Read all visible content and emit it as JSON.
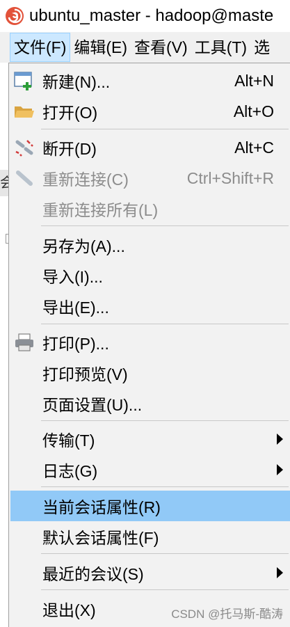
{
  "window": {
    "title": "ubuntu_master - hadoop@maste",
    "app_icon": "swirl-app-icon"
  },
  "menubar": {
    "items": [
      "文件(F)",
      "编辑(E)",
      "查看(V)",
      "工具(T)",
      "选"
    ]
  },
  "background": {
    "tab_fragment": "会"
  },
  "file_menu": {
    "items": [
      {
        "label": "新建(N)...",
        "shortcut": "Alt+N",
        "icon": "new-session-icon",
        "enabled": true
      },
      {
        "label": "打开(O)",
        "shortcut": "Alt+O",
        "icon": "open-folder-icon",
        "enabled": true
      },
      {
        "label": "断开(D)",
        "shortcut": "Alt+C",
        "icon": "disconnect-icon",
        "enabled": true
      },
      {
        "label": "重新连接(C)",
        "shortcut": "Ctrl+Shift+R",
        "icon": "reconnect-icon",
        "enabled": false
      },
      {
        "label": "重新连接所有(L)",
        "shortcut": "",
        "enabled": false
      },
      {
        "label": "另存为(A)...",
        "shortcut": "",
        "enabled": true
      },
      {
        "label": "导入(I)...",
        "shortcut": "",
        "enabled": true
      },
      {
        "label": "导出(E)...",
        "shortcut": "",
        "enabled": true
      },
      {
        "label": "打印(P)...",
        "shortcut": "",
        "icon": "printer-icon",
        "enabled": true
      },
      {
        "label": "打印预览(V)",
        "shortcut": "",
        "enabled": true
      },
      {
        "label": "页面设置(U)...",
        "shortcut": "",
        "enabled": true
      },
      {
        "label": "传输(T)",
        "shortcut": "",
        "submenu": true,
        "enabled": true
      },
      {
        "label": "日志(G)",
        "shortcut": "",
        "submenu": true,
        "enabled": true
      },
      {
        "label": "当前会话属性(R)",
        "shortcut": "",
        "highlighted": true,
        "enabled": true
      },
      {
        "label": "默认会话属性(F)",
        "shortcut": "",
        "enabled": true
      },
      {
        "label": "最近的会议(S)",
        "shortcut": "",
        "submenu": true,
        "enabled": true
      },
      {
        "label": "退出(X)",
        "shortcut": "",
        "enabled": true
      }
    ]
  },
  "watermark": "CSDN @托马斯-酷涛",
  "colors": {
    "highlight": "#91c9f7",
    "menubar_active": "#cce8ff",
    "disabled_text": "#8c8c8c"
  }
}
